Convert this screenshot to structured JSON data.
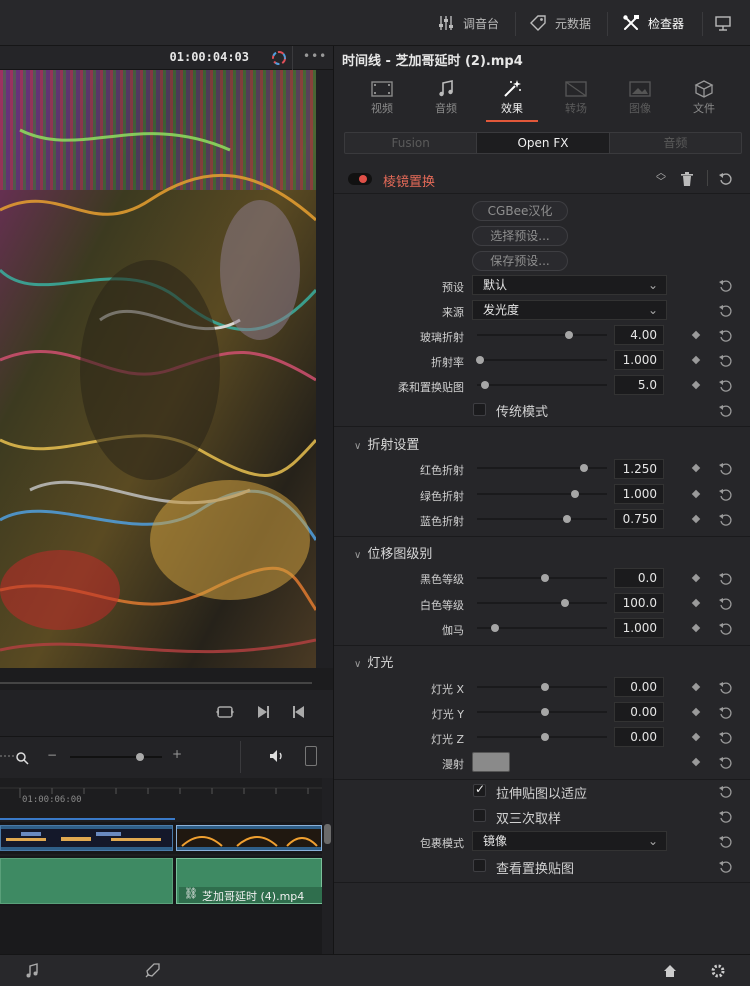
{
  "topbar": {
    "items": [
      {
        "label": "调音台",
        "icon": "mixer-icon"
      },
      {
        "label": "元数据",
        "icon": "metadata-tag-icon"
      },
      {
        "label": "检查器",
        "icon": "inspector-tools-icon"
      }
    ]
  },
  "viewer": {
    "timecode": "01:00:04:03"
  },
  "timeline": {
    "ruler_time": "01:00:06:00",
    "audio_clip_name": "芝加哥延时 (4).mp4"
  },
  "inspector": {
    "title": "时间线 - 芝加哥延时 (2).mp4",
    "tabs": [
      {
        "label": "视频",
        "icon": "video-film-icon",
        "state": "normal"
      },
      {
        "label": "音频",
        "icon": "music-note-icon",
        "state": "normal"
      },
      {
        "label": "效果",
        "icon": "magic-wand-icon",
        "state": "active"
      },
      {
        "label": "转场",
        "icon": "transition-icon",
        "state": "dim"
      },
      {
        "label": "图像",
        "icon": "image-icon",
        "state": "dim"
      },
      {
        "label": "文件",
        "icon": "file-icon",
        "state": "normal"
      }
    ],
    "subtabs": [
      "Fusion",
      "Open FX",
      "音频"
    ],
    "effect_name": "棱镜置换",
    "buttons": {
      "cgbee": "CGBee汉化",
      "select_preset": "选择预设...",
      "save_preset": "保存预设..."
    },
    "preset": {
      "label": "预设",
      "value": "默认"
    },
    "source": {
      "label": "来源",
      "value": "发光度"
    },
    "params": [
      {
        "label": "玻璃折射",
        "value": "4.00",
        "pos": 0.71
      },
      {
        "label": "折射率",
        "value": "1.000",
        "pos": 0.02
      },
      {
        "label": "柔和置换贴图",
        "value": "5.0",
        "pos": 0.06
      }
    ],
    "legacy_mode": {
      "label": "传统模式",
      "checked": false
    },
    "refraction": {
      "title": "折射设置",
      "params": [
        {
          "label": "红色折射",
          "value": "1.250",
          "pos": 0.82
        },
        {
          "label": "绿色折射",
          "value": "1.000",
          "pos": 0.75
        },
        {
          "label": "蓝色折射",
          "value": "0.750",
          "pos": 0.69
        }
      ]
    },
    "levels": {
      "title": "位移图级别",
      "params": [
        {
          "label": "黑色等级",
          "value": "0.0",
          "pos": 0.52
        },
        {
          "label": "白色等级",
          "value": "100.0",
          "pos": 0.68
        },
        {
          "label": "伽马",
          "value": "1.000",
          "pos": 0.14
        }
      ]
    },
    "lighting": {
      "title": "灯光",
      "params": [
        {
          "label": "灯光 X",
          "value": "0.00",
          "pos": 0.52
        },
        {
          "label": "灯光 Y",
          "value": "0.00",
          "pos": 0.52
        },
        {
          "label": "灯光 Z",
          "value": "0.00",
          "pos": 0.52
        }
      ],
      "diffuse_label": "漫射",
      "diffuse_color": "#8a8a8a"
    },
    "options": {
      "stretch": {
        "label": "拉伸贴图以适应",
        "checked": true
      },
      "bicubic": {
        "label": "双三次取样",
        "checked": false
      },
      "wrap": {
        "label": "包裹模式",
        "value": "镜像"
      },
      "view_map": {
        "label": "查看置换贴图",
        "checked": false
      }
    }
  },
  "colors": {
    "accent": "#e2583a",
    "effect_name": "#e46a58",
    "clip_video": "#2f5f88",
    "clip_audio": "#3e8a63"
  }
}
